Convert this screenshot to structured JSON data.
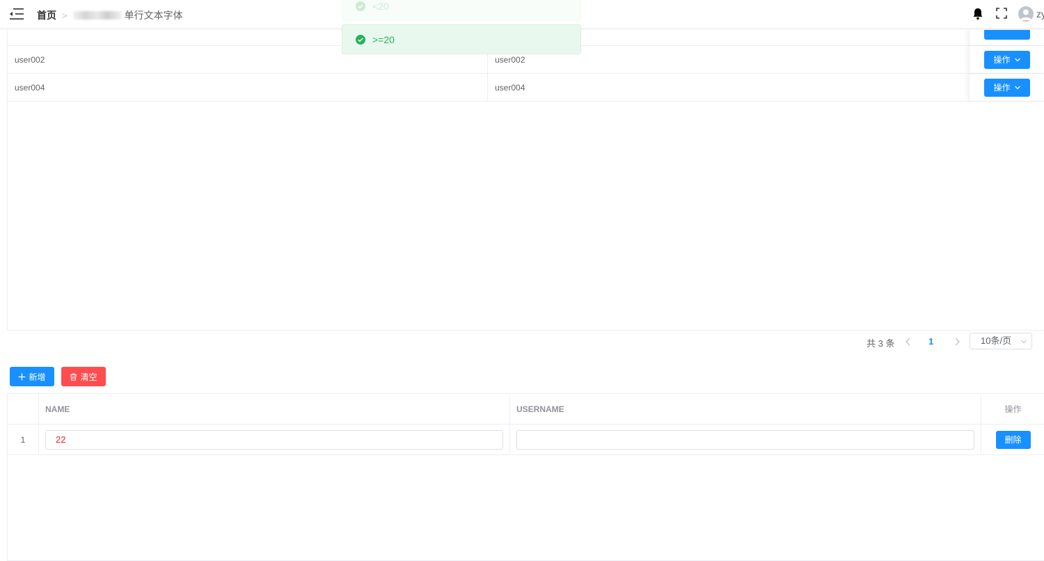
{
  "header": {
    "breadcrumb_home": "首页",
    "breadcrumb_current": "单行文本字体",
    "user_name": "zy",
    "icons": [
      "menu-fold-icon",
      "bell-icon",
      "fullscreen-icon",
      "user-avatar-icon"
    ]
  },
  "toasts": [
    {
      "text": "<20",
      "type": "success",
      "faded": true
    },
    {
      "text": ">=20",
      "type": "success",
      "faded": false
    }
  ],
  "top_table": {
    "rows": [
      {
        "name": "user002",
        "username": "user002",
        "action": "操作"
      },
      {
        "name": "user004",
        "username": "user004",
        "action": "操作"
      }
    ]
  },
  "pagination": {
    "total": "共 3 条",
    "current_page": "1",
    "page_size": "10条/页"
  },
  "actions": {
    "add_label": "新增",
    "clear_label": "清空"
  },
  "bottom_table": {
    "headers": {
      "name": "NAME",
      "username": "USERNAME",
      "action": "操作"
    },
    "rows": [
      {
        "index": "1",
        "name": "22",
        "username": "",
        "delete_label": "删除"
      }
    ]
  },
  "colors": {
    "primary": "#1890ff",
    "danger": "#ff4d4f",
    "success": "#27b15b",
    "error_text": "#f5222d"
  }
}
